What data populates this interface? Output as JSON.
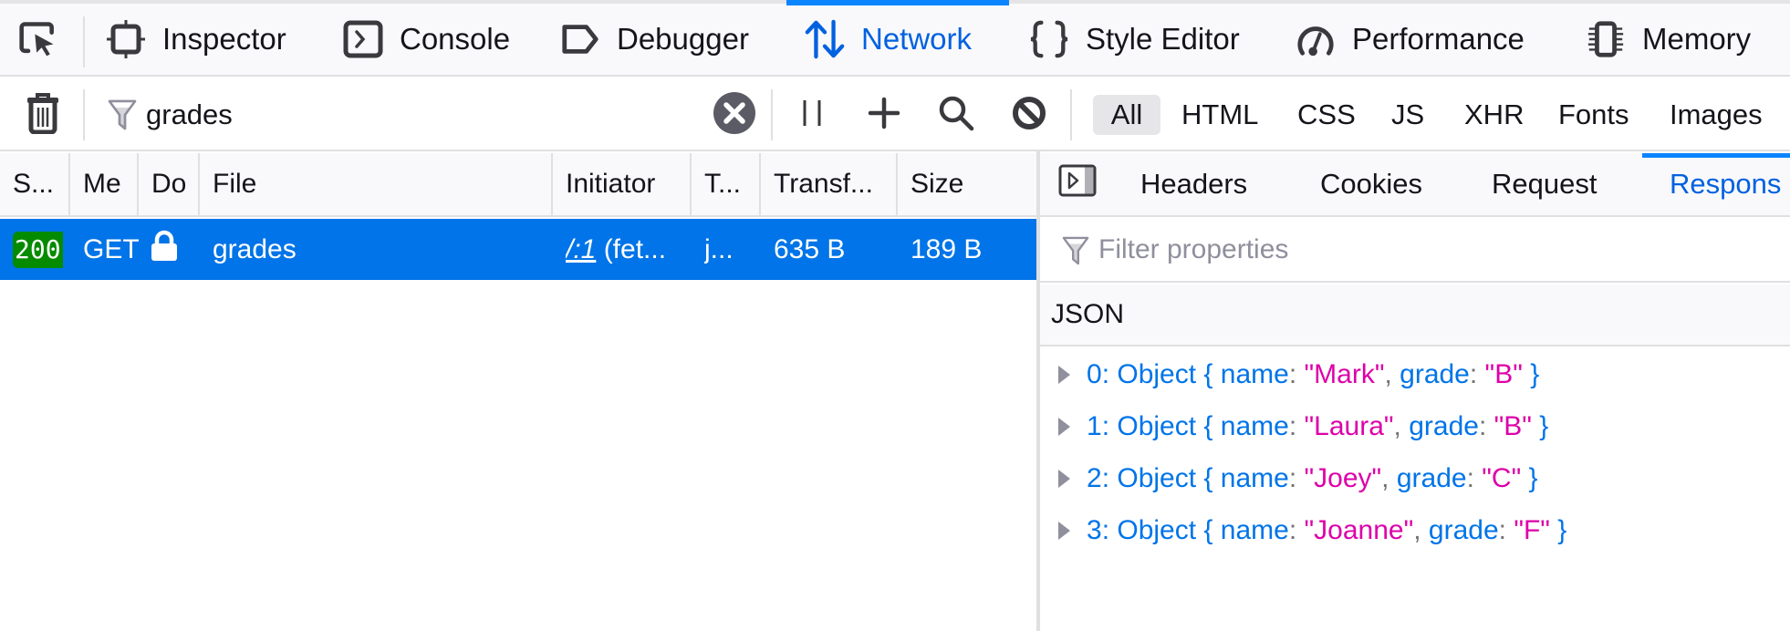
{
  "toolbar": {
    "picker_icon": "element-picker-icon",
    "tabs": [
      {
        "label": "Inspector",
        "icon": "inspector-icon",
        "active": false
      },
      {
        "label": "Console",
        "icon": "console-icon",
        "active": false
      },
      {
        "label": "Debugger",
        "icon": "debugger-icon",
        "active": false
      },
      {
        "label": "Network",
        "icon": "network-arrows-icon",
        "active": true
      },
      {
        "label": "Style Editor",
        "icon": "braces-icon",
        "active": false
      },
      {
        "label": "Performance",
        "icon": "gauge-icon",
        "active": false
      },
      {
        "label": "Memory",
        "icon": "chip-icon",
        "active": false
      }
    ]
  },
  "filterbar": {
    "url_filter_value": "grades",
    "buttons": {
      "clear_requests": "trash-icon",
      "clear_filter": "clear-x-icon",
      "pause": "pause-icon",
      "add_blocking": "plus-icon",
      "search": "search-icon",
      "block": "block-icon"
    },
    "types": [
      {
        "label": "All",
        "active": true
      },
      {
        "label": "HTML",
        "active": false
      },
      {
        "label": "CSS",
        "active": false
      },
      {
        "label": "JS",
        "active": false
      },
      {
        "label": "XHR",
        "active": false
      },
      {
        "label": "Fonts",
        "active": false
      },
      {
        "label": "Images",
        "active": false
      }
    ]
  },
  "requests": {
    "columns": [
      "S...",
      "Me",
      "Do",
      "File",
      "Initiator",
      "T...",
      "Transf...",
      "Size"
    ],
    "rows": [
      {
        "status": "200",
        "method": "GET",
        "domain_icon": "lock-icon",
        "file": "grades",
        "initiator_link": "/:1",
        "initiator_rest": " (fet...",
        "type": "j...",
        "transferred": "635 B",
        "size": "189 B",
        "selected": true
      }
    ]
  },
  "details": {
    "tabs": [
      {
        "label": "Headers",
        "active": false
      },
      {
        "label": "Cookies",
        "active": false
      },
      {
        "label": "Request",
        "active": false
      },
      {
        "label": "Respons",
        "active": true
      }
    ],
    "filter_placeholder": "Filter properties",
    "section_title": "JSON",
    "items": [
      {
        "index": "0",
        "type": "Object",
        "name": "\"Mark\"",
        "grade": "\"B\""
      },
      {
        "index": "1",
        "type": "Object",
        "name": "\"Laura\"",
        "grade": "\"B\""
      },
      {
        "index": "2",
        "type": "Object",
        "name": "\"Joey\"",
        "grade": "\"C\""
      },
      {
        "index": "3",
        "type": "Object",
        "name": "\"Joanne\"",
        "grade": "\"F\""
      }
    ],
    "key_labels": {
      "name": "name",
      "grade": "grade"
    }
  },
  "colors": {
    "accent": "#0a84ff",
    "selected_row": "#0074e8",
    "status_ok": "#058b00",
    "json_string": "#dd00a9",
    "json_key": "#0074e8"
  }
}
